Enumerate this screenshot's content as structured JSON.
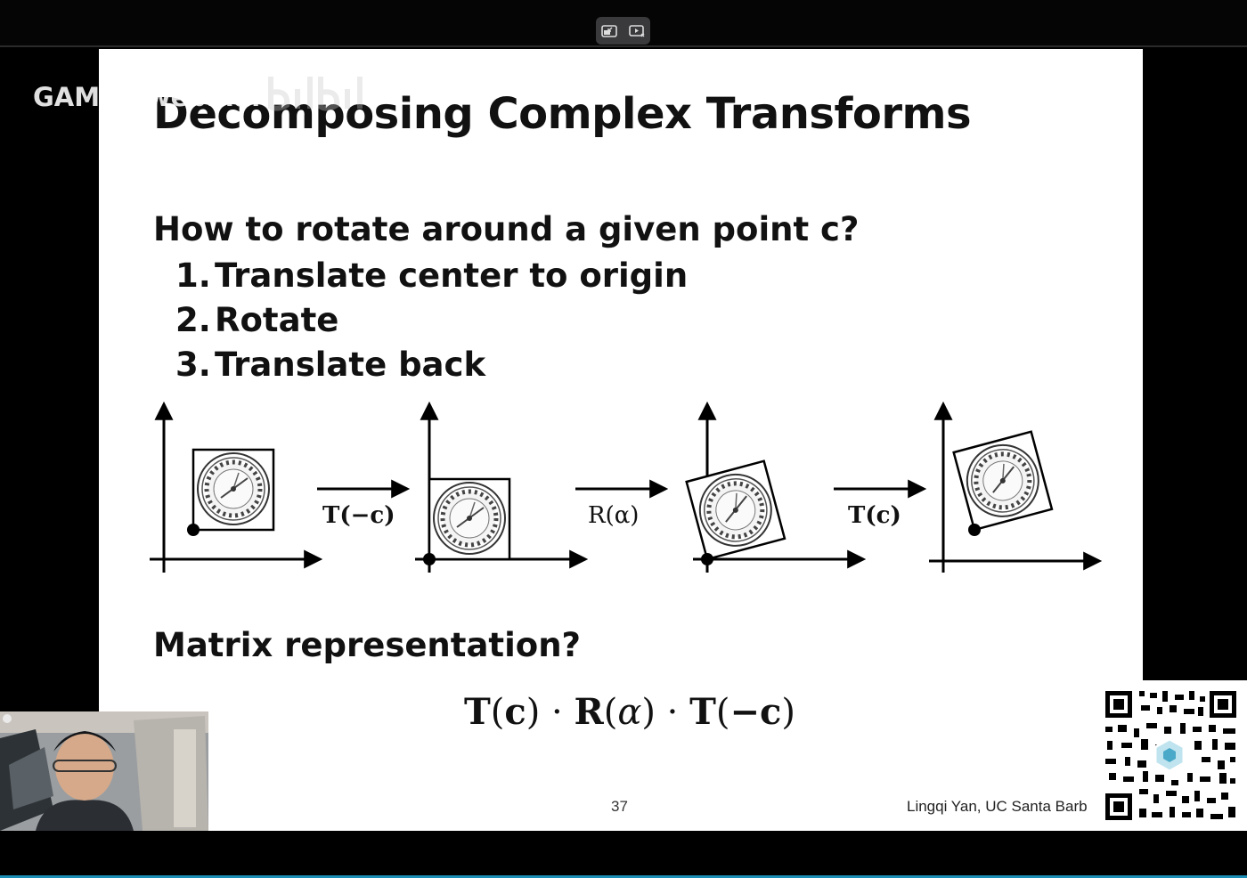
{
  "watermark": {
    "text": "GAMES-webinar"
  },
  "slide": {
    "title": "Decomposing Complex Transforms",
    "question": "How to rotate around a given point c?",
    "steps": [
      {
        "num": "1.",
        "text": "Translate center to origin"
      },
      {
        "num": "2.",
        "text": "Rotate"
      },
      {
        "num": "3.",
        "text": "Translate back"
      }
    ],
    "diagram": {
      "arrow_labels": [
        "T(−c)",
        "R(α)",
        "T(c)"
      ]
    },
    "matrix_question": "Matrix representation?",
    "formula": {
      "t1": "T",
      "c1": "c",
      "r": "R",
      "alpha1": "α",
      "t2": "T",
      "c2": "−c"
    },
    "page_number": "37",
    "credit": "Lingqi Yan, UC Santa Barb"
  },
  "colors": {
    "slide_bg": "#ffffff",
    "frame_bg": "#000000",
    "pill_bg": "#3a3a3d",
    "accent_edge": "#1d8fb6"
  }
}
